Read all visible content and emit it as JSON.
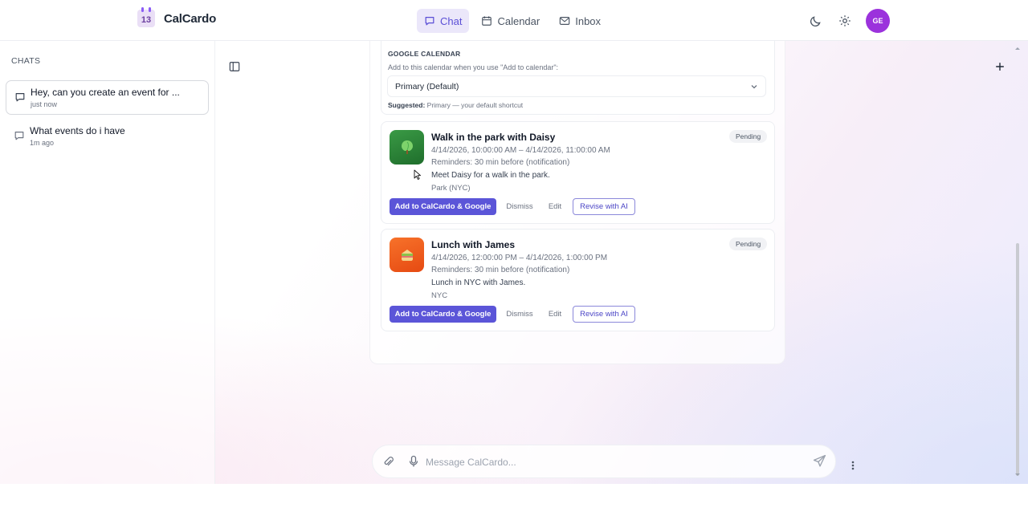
{
  "app": {
    "name": "CalCardo",
    "logo_day": "13"
  },
  "nav": {
    "items": [
      {
        "label": "Chat",
        "active": true
      },
      {
        "label": "Calendar"
      },
      {
        "label": "Inbox"
      }
    ]
  },
  "user": {
    "initials": "GE",
    "avatar_color": "#9b32dc"
  },
  "sidebar": {
    "heading": "CHATS",
    "chats": [
      {
        "title": "Hey, can you create an event for ...",
        "time": "just now",
        "active": true
      },
      {
        "title": "What events do i have",
        "time": "1m ago"
      }
    ]
  },
  "google_calendar": {
    "title": "GOOGLE CALENDAR",
    "description": "Add to this calendar when you use \"Add to calendar\":",
    "selected": "Primary (Default)",
    "suggested_label": "Suggested:",
    "suggested_value": "Primary — your default shortcut"
  },
  "events": [
    {
      "title": "Walk in the park with Daisy",
      "time": "4/14/2026, 10:00:00 AM – 4/14/2026, 11:00:00 AM",
      "reminders": "Reminders: 30 min before (notification)",
      "description": "Meet Daisy for a walk in the park.",
      "location": "Park (NYC)",
      "status": "Pending",
      "icon": "tree-icon",
      "color": "#2f8a3c"
    },
    {
      "title": "Lunch with James",
      "time": "4/14/2026, 12:00:00 PM – 4/14/2026, 1:00:00 PM",
      "reminders": "Reminders: 30 min before (notification)",
      "description": "Lunch in NYC with James.",
      "location": "NYC",
      "status": "Pending",
      "icon": "sandwich-icon",
      "color": "#f05a1a"
    }
  ],
  "actions": {
    "add": "Add to CalCardo & Google",
    "dismiss": "Dismiss",
    "edit": "Edit",
    "revise": "Revise with AI"
  },
  "composer": {
    "placeholder": "Message CalCardo..."
  },
  "colors": {
    "accent": "#5b55d8",
    "nav_active_bg": "#ebe7fa"
  }
}
